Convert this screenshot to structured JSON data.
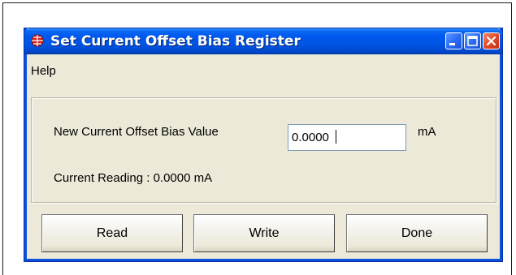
{
  "window": {
    "title": "Set Current Offset Bias Register"
  },
  "menu": {
    "help_label": "Help"
  },
  "form": {
    "new_value_label": "New Current Offset Bias Value",
    "new_value": "0.0000",
    "unit": "mA",
    "current_reading": "Current Reading : 0.0000 mA"
  },
  "buttons": {
    "read": "Read",
    "write": "Write",
    "done": "Done"
  },
  "icons": {
    "app": "red-globe-icon",
    "minimize": "minimize-icon",
    "maximize": "maximize-icon",
    "close": "close-icon"
  },
  "colors": {
    "titlebar": "#0055E5",
    "window_face": "#ECE9D8",
    "close_button": "#E04A2A"
  }
}
